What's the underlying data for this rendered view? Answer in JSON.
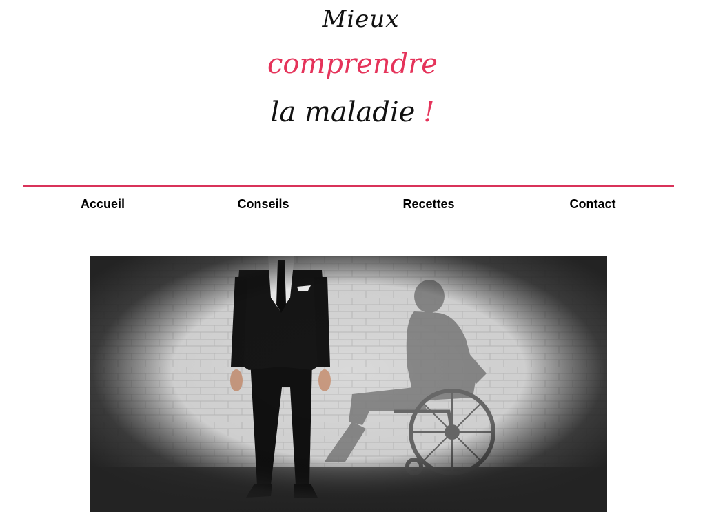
{
  "logo": {
    "line1": "Mieux",
    "line2": "comprendre",
    "line3": "la maladie",
    "exclamation": "!",
    "accent_color": "#e5335a"
  },
  "nav": {
    "items": [
      {
        "label": "Accueil"
      },
      {
        "label": "Conseils"
      },
      {
        "label": "Recettes"
      },
      {
        "label": "Contact"
      }
    ]
  },
  "hero": {
    "icon": "man-in-suit-with-wheelchair-shadow-photo"
  }
}
